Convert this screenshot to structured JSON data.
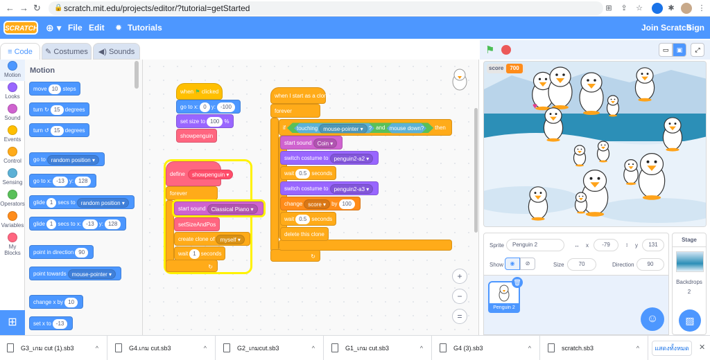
{
  "browser": {
    "url": "scratch.mit.edu/projects/editor/?tutorial=getStarted"
  },
  "menu": {
    "logo": "SCRATCH",
    "file": "File",
    "edit": "Edit",
    "tutorials": "Tutorials",
    "join": "Join Scratch",
    "signin": "Sign in"
  },
  "tabs": {
    "code": "Code",
    "costumes": "Costumes",
    "sounds": "Sounds"
  },
  "categories": [
    {
      "label": "Motion",
      "color": "#4c97ff"
    },
    {
      "label": "Looks",
      "color": "#9966ff"
    },
    {
      "label": "Sound",
      "color": "#cf63cf"
    },
    {
      "label": "Events",
      "color": "#ffbf00"
    },
    {
      "label": "Control",
      "color": "#ffab19"
    },
    {
      "label": "Sensing",
      "color": "#5cb1d6"
    },
    {
      "label": "Operators",
      "color": "#59c059"
    },
    {
      "label": "Variables",
      "color": "#ff8c1a"
    },
    {
      "label": "My Blocks",
      "color": "#ff6680"
    }
  ],
  "palette": {
    "title": "Motion",
    "move": "move",
    "move_val": "10",
    "move_steps": "steps",
    "turn": "turn",
    "turn_val1": "15",
    "turn_val2": "15",
    "degrees": "degrees",
    "goto": "go to",
    "goto_random": "random position",
    "gotox": "go to x:",
    "gotox_x": "-13",
    "gotox_y_label": "y:",
    "gotox_y": "128",
    "glide": "glide",
    "glide_val": "1",
    "glide_secs": "secs to",
    "glide_random": "random position",
    "glide2_secs": "secs to x:",
    "glide2_x": "-13",
    "glide2_y_label": "y:",
    "glide2_y": "128",
    "point_dir": "point in direction",
    "point_dir_val": "90",
    "point_towards": "point towards",
    "point_towards_val": "mouse-pointer",
    "changex": "change x by",
    "changex_val": "10",
    "setx": "set x to",
    "setx_val": "-13"
  },
  "script1": {
    "when": "when",
    "clicked": "clicked",
    "goto": "go to x:",
    "x": "0",
    "y_label": "y:",
    "y": "-100",
    "setsize": "set size to",
    "size": "100",
    "pct": "%",
    "showpenguin": "showpenguin"
  },
  "script2": {
    "define": "define",
    "name": "showpenguin",
    "forever": "forever",
    "startsound": "start sound",
    "sound": "Classical Piano",
    "setsizepos": "setSizeAndPos",
    "createclone": "create clone of",
    "clone": "myself",
    "wait": "wait",
    "wait_val": "1",
    "seconds": "seconds"
  },
  "script3": {
    "hat": "when I start as a clone",
    "forever": "forever",
    "if": "if",
    "touching": "touching",
    "touch_target": "mouse-pointer",
    "q": "?",
    "and": "and",
    "mousedown": "mouse down?",
    "then": "then",
    "startsound": "start sound",
    "sound": "Coin",
    "switch": "switch costume to",
    "costume1": "penguin2-a2",
    "costume2": "penguin2-a3",
    "wait": "wait",
    "wait1": "0.5",
    "wait2": "0.5",
    "seconds": "seconds",
    "change": "change",
    "var": "score",
    "by": "by",
    "by_val": "100",
    "delete": "delete this clone"
  },
  "zoom": {
    "in": "+",
    "out": "−",
    "reset": "="
  },
  "stage": {
    "score_label": "score",
    "score_val": "700"
  },
  "sprite": {
    "label": "Sprite",
    "name": "Penguin 2",
    "x_label": "x",
    "x": "-79",
    "y_label": "y",
    "y": "131",
    "show": "Show",
    "size_label": "Size",
    "size": "70",
    "dir_label": "Direction",
    "dir": "90",
    "thumb_name": "Penguin 2"
  },
  "stagepanel": {
    "title": "Stage",
    "backdrops": "Backdrops",
    "count": "2"
  },
  "downloads": [
    {
      "name": "G3_เกม cut (1).sb3"
    },
    {
      "name": "G4.เกม cut.sb3"
    },
    {
      "name": "G2_เกมcut.sb3"
    },
    {
      "name": "G1_เกม cut.sb3"
    },
    {
      "name": "G4 (3).sb3"
    },
    {
      "name": "scratch.sb3"
    }
  ],
  "download_showall": "แสดงทั้งหมด"
}
